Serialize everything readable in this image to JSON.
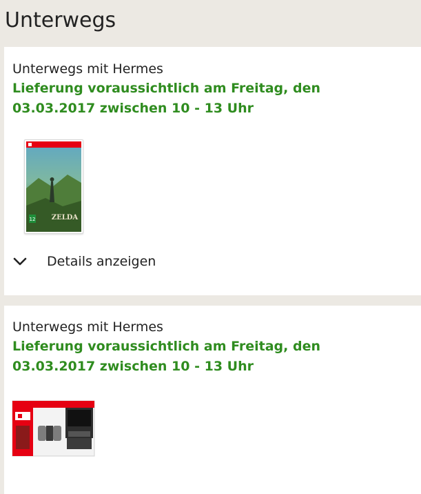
{
  "page": {
    "title": "Unterwegs"
  },
  "shipments": [
    {
      "carrier": "Unterwegs mit Hermes",
      "delivery_line1": "Lieferung voraussichtlich am Freitag, den",
      "delivery_line2": "03.03.2017 zwischen 10 - 13 Uhr",
      "product_image_icon": "zelda-game-cover",
      "details_label": "Details anzeigen"
    },
    {
      "carrier": "Unterwegs mit Hermes",
      "delivery_line1": "Lieferung voraussichtlich am Freitag, den",
      "delivery_line2": "03.03.2017 zwischen 10 - 13 Uhr",
      "product_image_icon": "nintendo-switch-box"
    }
  ],
  "colors": {
    "background": "#ece9e3",
    "card": "#ffffff",
    "delivery_green": "#2f8c1f",
    "text": "#222222"
  }
}
